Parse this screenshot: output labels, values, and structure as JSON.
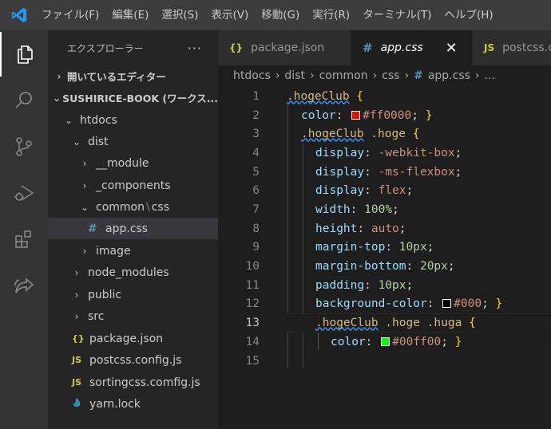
{
  "titlebar": {
    "logo_icon": "vscode-logo-icon",
    "menu": [
      "ファイル(F)",
      "編集(E)",
      "選択(S)",
      "表示(V)",
      "移動(G)",
      "実行(R)",
      "ターミナル(T)",
      "ヘルプ(H)"
    ]
  },
  "activitybar": {
    "items": [
      "explorer-icon",
      "search-icon",
      "source-control-icon",
      "run-debug-icon",
      "extensions-icon",
      "live-share-icon"
    ],
    "active": "explorer-icon"
  },
  "sidebar": {
    "title": "エクスプローラー",
    "more": "···",
    "open_editors": "開いているエディター",
    "workspace": "SUSHIRICE-BOOK (ワークス...",
    "tree": {
      "htdocs": "htdocs",
      "dist": "dist",
      "module": "__module",
      "components": "_components",
      "common": "common",
      "common_sep": "\\",
      "css": "css",
      "appcss": "app.css",
      "image": "image",
      "node_modules": "node_modules",
      "public": "public",
      "src": "src",
      "package_json": "package.json",
      "postcss_config": "postcss.config.js",
      "sortingcss_config": "sortingcss.comfig.js",
      "yarn_lock": "yarn.lock"
    },
    "file_icons": {
      "json": "{}",
      "js": "JS",
      "css": "#"
    }
  },
  "tabs": [
    {
      "icon": "{}",
      "label": "package.json",
      "active": false
    },
    {
      "icon": "#",
      "label": "app.css",
      "active": true,
      "close": "✕"
    },
    {
      "icon": "JS",
      "label": "postcss.c",
      "active": false
    }
  ],
  "breadcrumb": {
    "parts": [
      "htdocs",
      "dist",
      "common",
      "css"
    ],
    "file_icon": "#",
    "file": "app.css",
    "more": "..."
  },
  "editor": {
    "line_numbers": [
      "1",
      "2",
      "3",
      "4",
      "5",
      "6",
      "7",
      "8",
      "9",
      "10",
      "11",
      "12",
      "13",
      "14",
      "15"
    ],
    "current_line": "13",
    "colors": {
      "red": "#ff0000",
      "black": "#000",
      "green": "#00ff00"
    },
    "code": {
      "l1_sel": ".hogeClub",
      "l1_brace": " {",
      "l2_prop": "color",
      "l2_colon": ": ",
      "l2_val": "#ff0000",
      "l2_end": ";",
      "l2_brace": " }",
      "l3_sel_a": ".hogeClub",
      "l3_sel_b": " .hoge",
      "l3_brace": " {",
      "l4_prop": "display",
      "l4_val": "-webkit-box",
      "l5_prop": "display",
      "l5_val": "-ms-flexbox",
      "l6_prop": "display",
      "l6_val": "flex",
      "l7_prop": "width",
      "l7_val": "100%",
      "l8_prop": "height",
      "l8_val": "auto",
      "l9_prop": "margin-top",
      "l9_val": "10px",
      "l10_prop": "margin-bottom",
      "l10_val": "20px",
      "l11_prop": "padding",
      "l11_val": "10px",
      "l12_prop": "background-color",
      "l12_val": "#000",
      "l12_brace": " }",
      "l13_sel_a": ".hogeClub",
      "l13_sel_b": " .hoge",
      "l13_sel_c": " .huga",
      "l13_brace": " {",
      "l14_prop": "color",
      "l14_val": "#00ff00",
      "l14_brace": " }",
      "colon": ": ",
      "semi": ";"
    }
  }
}
